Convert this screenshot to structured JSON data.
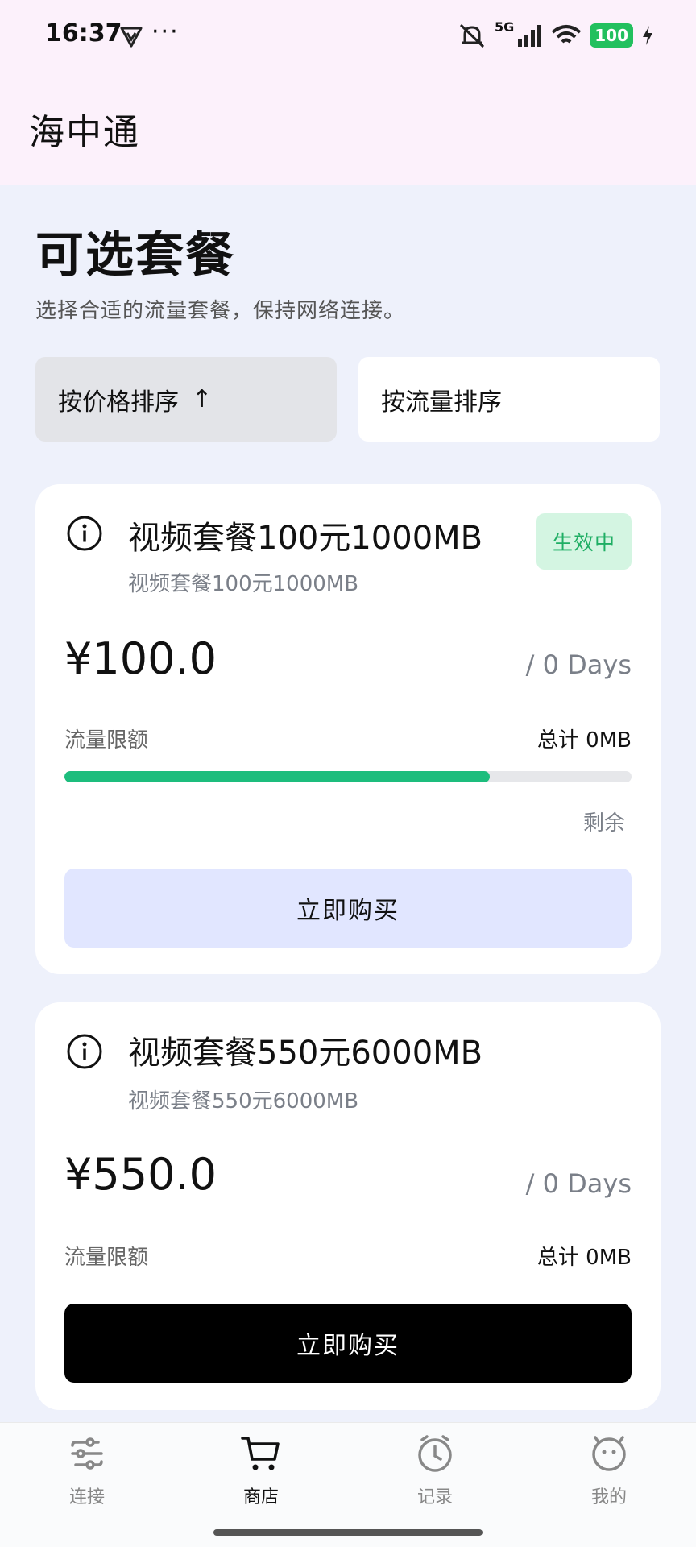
{
  "status_bar": {
    "time": "16:37",
    "dots": "···",
    "network": "5G",
    "battery": "100"
  },
  "app": {
    "title": "海中通"
  },
  "page": {
    "title": "可选套餐",
    "subtitle": "选择合适的流量套餐，保持网络连接。"
  },
  "sort": {
    "price_label": "按价格排序",
    "price_arrow": "↑",
    "flow_label": "按流量排序"
  },
  "plans": [
    {
      "name": "视频套餐100元1000MB",
      "desc": "视频套餐100元1000MB",
      "badge": "生效中",
      "price": "¥100.0",
      "period": "/ 0 Days",
      "quota_label": "流量限额",
      "quota_total": "总计 0MB",
      "usage_fraction": 0.75,
      "remaining_label": "剩余",
      "buy_label": "立即购买"
    },
    {
      "name": "视频套餐550元6000MB",
      "desc": "视频套餐550元6000MB",
      "price": "¥550.0",
      "period": "/ 0 Days",
      "quota_label": "流量限额",
      "quota_total": "总计 0MB",
      "buy_label": "立即购买"
    }
  ],
  "nav": {
    "items": [
      {
        "label": "连接",
        "icon": "connect-icon",
        "active": false
      },
      {
        "label": "商店",
        "icon": "cart-icon",
        "active": true
      },
      {
        "label": "记录",
        "icon": "clock-icon",
        "active": false
      },
      {
        "label": "我的",
        "icon": "face-icon",
        "active": false
      }
    ]
  },
  "colors": {
    "accent_green": "#1dbd7d",
    "badge_bg": "#d4f5e2",
    "buy_secondary_bg": "#e1e6ff",
    "buy_primary_bg": "#000000"
  }
}
